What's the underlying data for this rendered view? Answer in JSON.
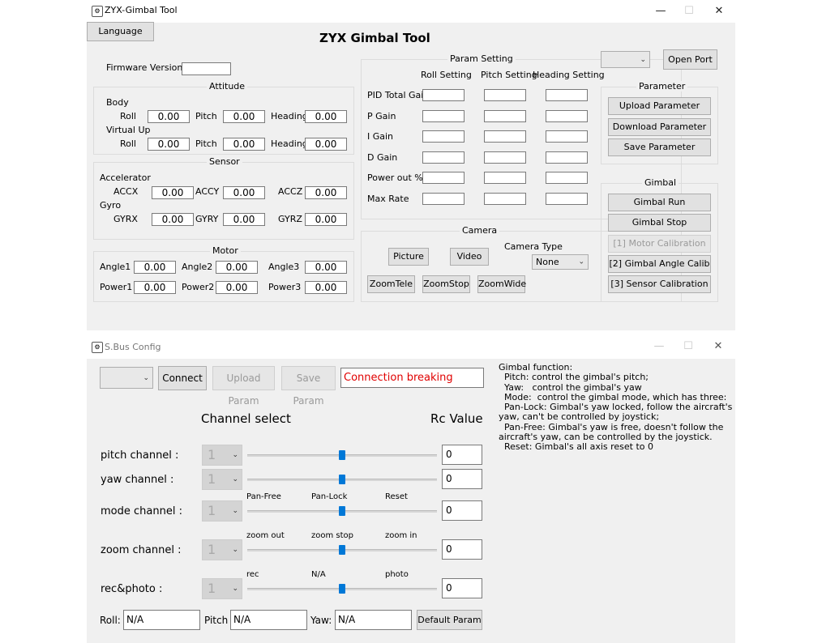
{
  "win1": {
    "title": "ZYX-Gimbal Tool",
    "heading": "ZYX Gimbal Tool",
    "language_btn": "Language",
    "open_port_btn": "Open Port",
    "firmware_label": "Firmware Version",
    "attitude": {
      "title": "Attitude",
      "body_label": "Body",
      "virtual_label": "Virtual Up",
      "roll": "Roll",
      "pitch": "Pitch",
      "heading": "Heading",
      "body_roll": "0.00",
      "body_pitch": "0.00",
      "body_heading": "0.00",
      "vu_roll": "0.00",
      "vu_pitch": "0.00",
      "vu_heading": "0.00"
    },
    "sensor": {
      "title": "Sensor",
      "accel_label": "Accelerator",
      "gyro_label": "Gyro",
      "accx": "ACCX",
      "accy": "ACCY",
      "accz": "ACCZ",
      "gyrx": "GYRX",
      "gyry": "GYRY",
      "gyrz": "GYRZ",
      "accx_v": "0.00",
      "accy_v": "0.00",
      "accz_v": "0.00",
      "gyrx_v": "0.00",
      "gyry_v": "0.00",
      "gyrz_v": "0.00"
    },
    "motor": {
      "title": "Motor",
      "angle1": "Angle1",
      "angle2": "Angle2",
      "angle3": "Angle3",
      "power1": "Power1",
      "power2": "Power2",
      "power3": "Power3",
      "angle1_v": "0.00",
      "angle2_v": "0.00",
      "angle3_v": "0.00",
      "power1_v": "0.00",
      "power2_v": "0.00",
      "power3_v": "0.00"
    },
    "param_setting": {
      "title": "Param Setting",
      "col_roll": "Roll Setting",
      "col_pitch": "Pitch Setting",
      "col_heading": "Heading Setting",
      "rows": [
        "PID Total Gain",
        "P Gain",
        "I Gain",
        "D Gain",
        "Power out %",
        "Max Rate"
      ]
    },
    "camera": {
      "title": "Camera",
      "picture": "Picture",
      "video": "Video",
      "type_label": "Camera Type",
      "type_value": "None",
      "zoom_tele": "ZoomTele",
      "zoom_stop": "ZoomStop",
      "zoom_wide": "ZoomWide"
    },
    "parameter": {
      "title": "Parameter",
      "upload": "Upload Parameter",
      "download": "Download Parameter",
      "save": "Save Parameter"
    },
    "gimbal": {
      "title": "Gimbal",
      "run": "Gimbal Run",
      "stop": "Gimbal Stop",
      "motor_cal": "[1] Motor Calibration",
      "angle_cal": "[2] Gimbal Angle Calib",
      "sensor_cal": "[3] Sensor Calibration"
    }
  },
  "win2": {
    "title": "S.Bus Config",
    "connect": "Connect",
    "upload_param": "Upload Param",
    "save_param": "Save Param",
    "status": "Connection breaking",
    "status_color": "#e00000",
    "channel_select": "Channel select",
    "rc_value": "Rc Value",
    "channels": [
      {
        "label": "pitch channel :",
        "sel": "1",
        "rc": "0",
        "level": 0.5
      },
      {
        "label": "yaw channel :",
        "sel": "1",
        "rc": "0",
        "level": 0.5
      },
      {
        "label": "mode channel :",
        "sel": "1",
        "rc": "0",
        "level": 0.5
      },
      {
        "label": "zoom channel :",
        "sel": "1",
        "rc": "0",
        "level": 0.5
      },
      {
        "label": "rec&photo :",
        "sel": "1",
        "rc": "0",
        "level": 0.5
      }
    ],
    "mode_ticks": [
      "Pan-Free",
      "Pan-Lock",
      "Reset"
    ],
    "zoom_ticks": [
      "zoom out",
      "zoom stop",
      "zoom in"
    ],
    "rec_ticks": [
      "rec",
      "N/A",
      "photo"
    ],
    "roll_label": "Roll:",
    "pitch_label": "Pitch",
    "yaw_label": "Yaw:",
    "roll_v": "N/A",
    "pitch_v": "N/A",
    "yaw_v": "N/A",
    "default_param": "Default Param",
    "help": [
      "Gimbal function:",
      "  Pitch: control the gimbal's pitch;",
      "  Yaw:   control the gimbal's yaw",
      "  Mode:  control the gimbal mode, which has three:",
      "  Pan-Lock: Gimbal's yaw locked, follow the aircraft's",
      "yaw, can't be controlled by joystick;",
      "  Pan-Free: Gimbal's yaw is free, doesn't follow the",
      "aircraft's yaw, can be controlled by the joystick.",
      "  Reset: Gimbal's all axis reset to 0"
    ]
  },
  "accent": "#0078d7"
}
